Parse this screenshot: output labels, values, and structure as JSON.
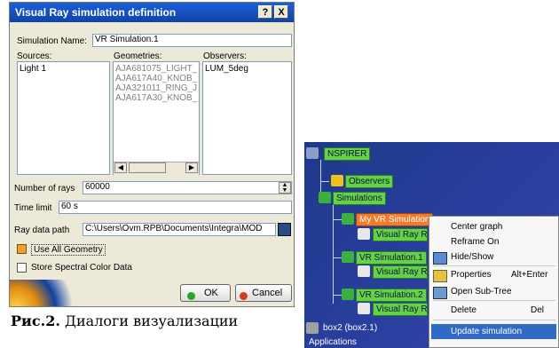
{
  "dialog": {
    "title": "Visual Ray simulation definition",
    "help_button": "?",
    "close_button": "X",
    "simulation_name_label": "Simulation Name:",
    "simulation_name_value": "VR Simulation.1",
    "sources_label": "Sources:",
    "geometries_label": "Geometries:",
    "observers_label": "Observers:",
    "sources": [
      "Light 1"
    ],
    "geometries": [
      "AJA681075_LIGHT_P",
      "AJA617A40_KNOB_1",
      "AJA321011_RING_J",
      "AJA617A30_KNOB_1"
    ],
    "observers": [
      "LUM_5deg"
    ],
    "number_of_rays_label": "Number of rays",
    "number_of_rays_value": "60000",
    "time_limit_label": "Time limit",
    "time_limit_value": "60 s",
    "ray_data_path_label": "Ray data path",
    "ray_data_path_value": "C:\\Users\\Ovm.RPB\\Documents\\Integra\\MOD",
    "use_all_geometry_label": "Use All Geometry",
    "use_all_geometry_checked": true,
    "store_spectral_label": "Store Spectral Color Data",
    "store_spectral_checked": false,
    "ok_label": "OK",
    "cancel_label": "Cancel"
  },
  "caption": {
    "bold": "Рис.2.",
    "text": " Диалоги визуализации"
  },
  "tree": {
    "root": "NSPIRER",
    "observers": "Observers",
    "simulations": "Simulations",
    "sim1": "My VR Simulation",
    "sim1_child": "Visual Ray R",
    "sim2": "VR Simulation.1",
    "sim2_child": "Visual Ray R",
    "sim3": "VR Simulation.2",
    "sim3_child": "Visual Ray R",
    "box": "box2 (box2.1)",
    "applications": "Applications"
  },
  "context_menu": {
    "items": [
      {
        "label": "Center graph",
        "shortcut": ""
      },
      {
        "label": "Reframe On",
        "shortcut": ""
      },
      {
        "label": "Hide/Show",
        "shortcut": ""
      },
      {
        "label": "Properties",
        "shortcut": "Alt+Enter"
      },
      {
        "label": "Open Sub-Tree",
        "shortcut": ""
      },
      {
        "label": "Delete",
        "shortcut": "Del"
      },
      {
        "label": "Update simulation",
        "shortcut": ""
      }
    ]
  },
  "colors": {
    "title_bar": "#1b5fd8",
    "dialog_bg": "#ece9d8",
    "tree_bg": "#1e3a8a",
    "node_green": "#63d24a",
    "node_orange": "#ef7b2b",
    "menu_highlight": "#316ac5"
  }
}
